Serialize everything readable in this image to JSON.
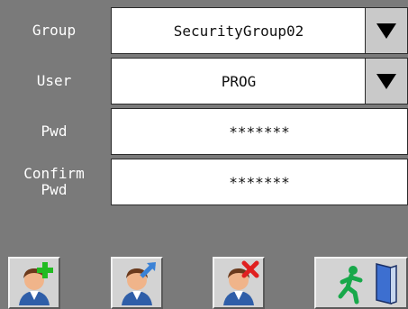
{
  "form": {
    "group_label": "Group",
    "group_value": "SecurityGroup02",
    "user_label": "User",
    "user_value": "PROG",
    "pwd_label": "Pwd",
    "pwd_value": "*******",
    "confirm_label_line1": "Confirm",
    "confirm_label_line2": "Pwd",
    "confirm_value": "*******"
  },
  "toolbar": {
    "add_user_icon": "add-user-icon",
    "edit_user_icon": "edit-user-icon",
    "delete_user_icon": "delete-user-icon",
    "exit_icon": "exit-door-icon"
  },
  "colors": {
    "background": "#7a7a7a",
    "button_face": "#d3d3d3",
    "add_green": "#22bb22",
    "edit_blue": "#3b82d6",
    "delete_red": "#e02020"
  }
}
